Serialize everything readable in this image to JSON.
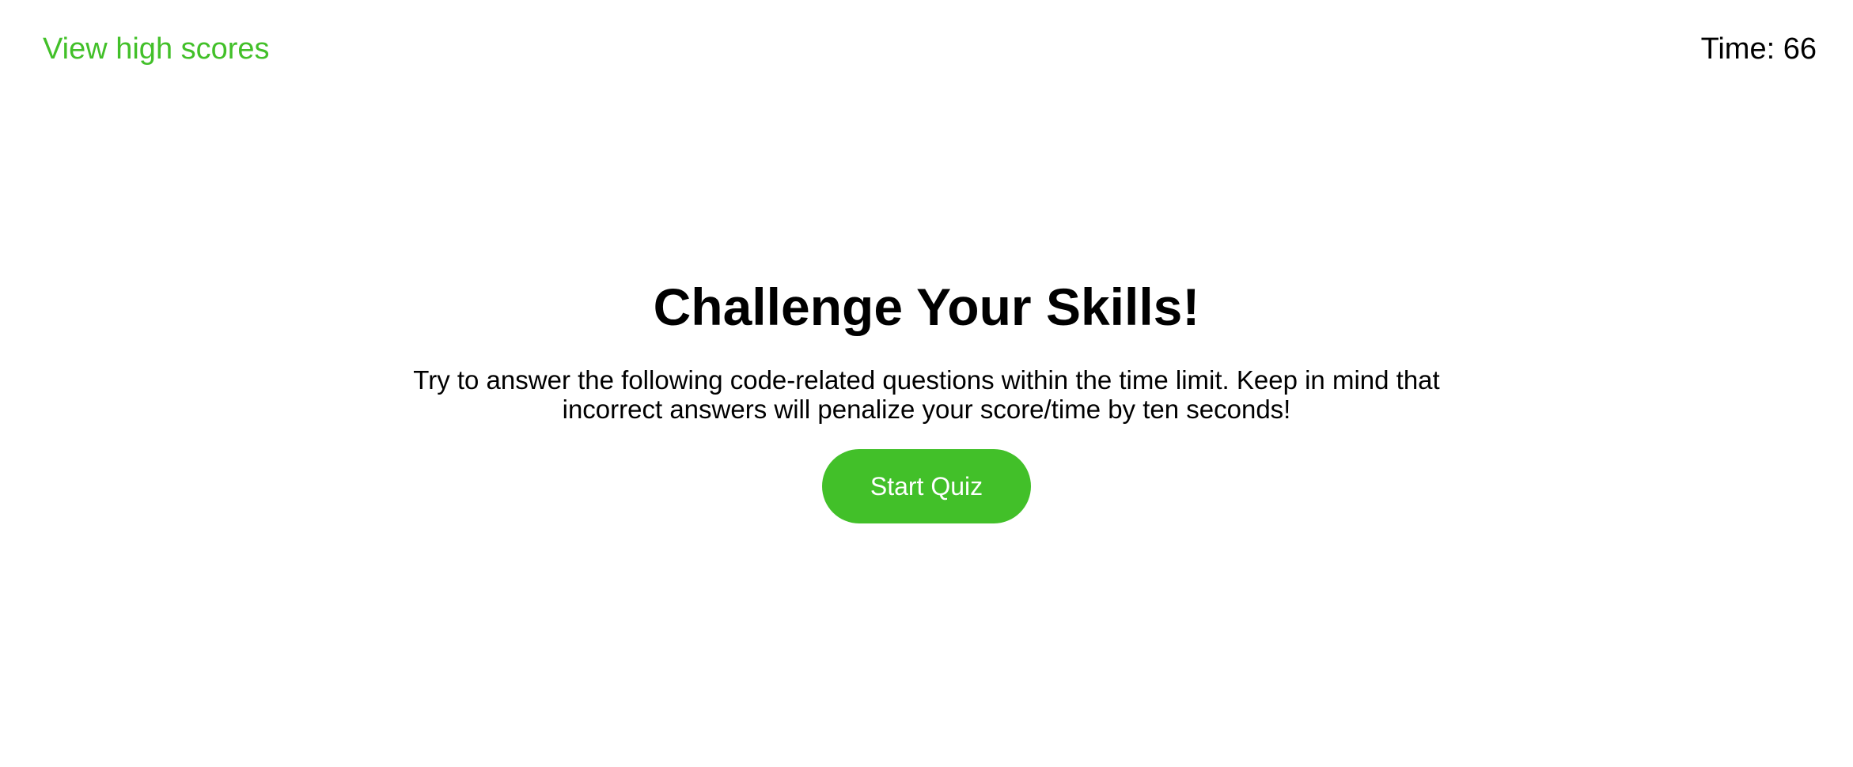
{
  "header": {
    "high_scores_label": "View high scores",
    "timer_label": "Time:",
    "timer_value": "66"
  },
  "main": {
    "title": "Challenge Your Skills!",
    "description": "Try to answer the following code-related questions within the time limit. Keep in mind that incorrect answers will penalize your score/time by ten seconds!",
    "start_button_label": "Start Quiz"
  },
  "colors": {
    "accent": "#42c029",
    "background": "#ffffff",
    "text": "#000000",
    "button_text": "#ffffff"
  }
}
